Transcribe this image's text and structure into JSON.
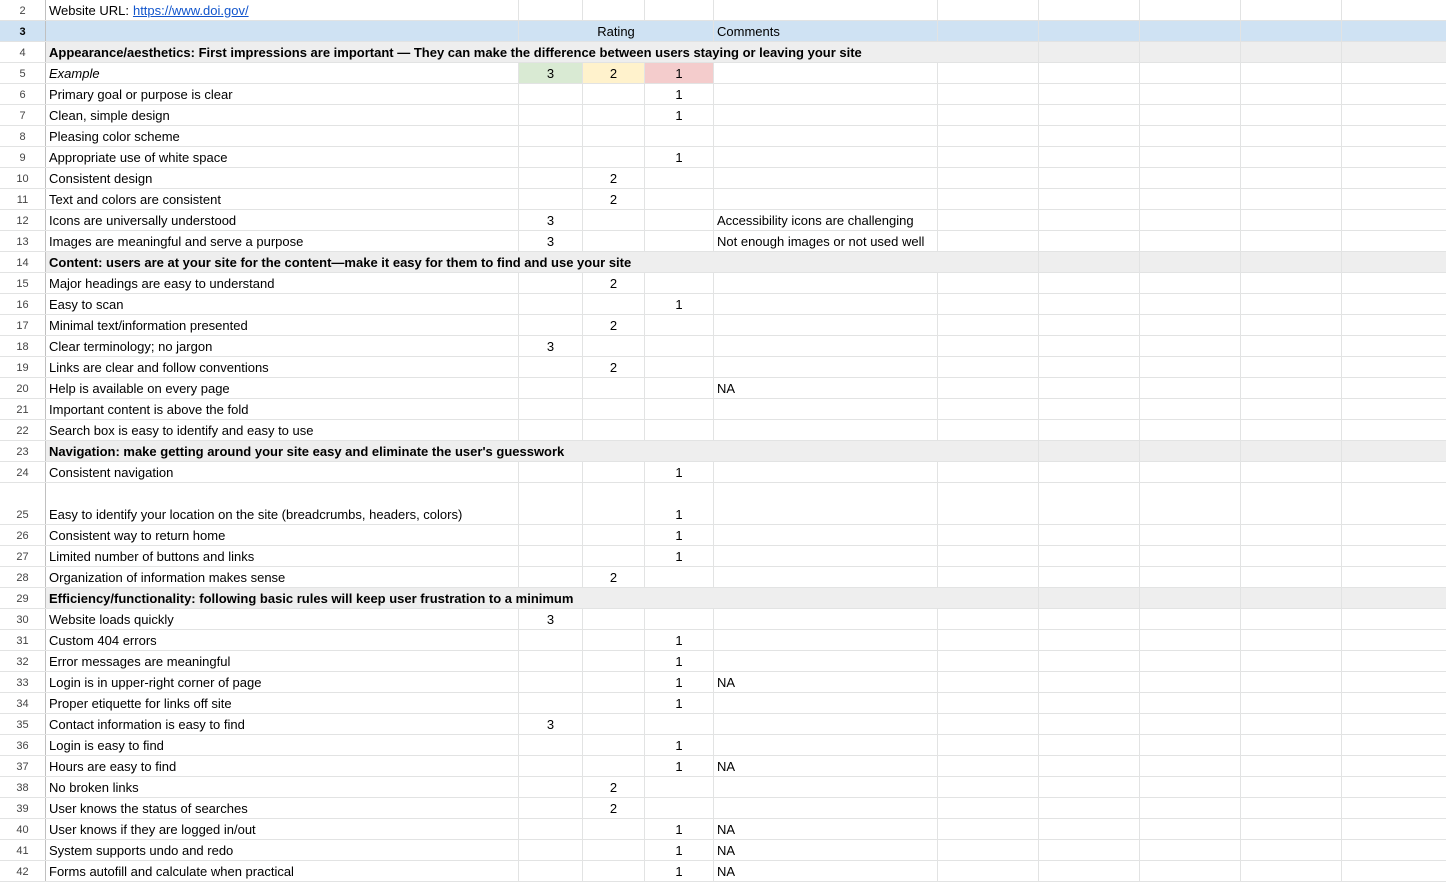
{
  "url_row": {
    "row_num": "2",
    "label": "Website URL:",
    "link": "https://www.doi.gov/"
  },
  "header": {
    "row_num": "3",
    "rating": "Rating",
    "comments": "Comments"
  },
  "rows": [
    {
      "n": "4",
      "type": "section",
      "a": "Appearance/aesthetics: First impressions are important — They can make the difference between users staying or leaving your site"
    },
    {
      "n": "5",
      "type": "example",
      "a": "Example",
      "b": "3",
      "c": "2",
      "d": "1"
    },
    {
      "n": "6",
      "a": "Primary goal or purpose is clear",
      "d": "1"
    },
    {
      "n": "7",
      "a": "Clean, simple design",
      "d": "1"
    },
    {
      "n": "8",
      "a": "Pleasing color scheme"
    },
    {
      "n": "9",
      "a": "Appropriate use of white space",
      "d": "1"
    },
    {
      "n": "10",
      "a": "Consistent design",
      "c": "2"
    },
    {
      "n": "11",
      "a": "Text and colors are consistent",
      "c": "2"
    },
    {
      "n": "12",
      "a": "Icons are universally understood",
      "b": "3",
      "e": "Accessibility icons are challenging"
    },
    {
      "n": "13",
      "a": "Images are meaningful and serve a purpose",
      "b": "3",
      "e": "Not enough images or not used well"
    },
    {
      "n": "14",
      "type": "section",
      "a": "Content: users are at your site for the content—make it easy for them to find and use your site"
    },
    {
      "n": "15",
      "a": "Major headings are easy to understand",
      "c": "2"
    },
    {
      "n": "16",
      "a": "Easy to scan",
      "d": "1"
    },
    {
      "n": "17",
      "a": "Minimal text/information presented",
      "c": "2"
    },
    {
      "n": "18",
      "a": "Clear terminology; no jargon",
      "b": "3"
    },
    {
      "n": "19",
      "a": "Links are clear and follow conventions",
      "c": "2"
    },
    {
      "n": "20",
      "a": "Help is available on every page",
      "e": "NA"
    },
    {
      "n": "21",
      "a": "Important content is above the fold"
    },
    {
      "n": "22",
      "a": "Search box is easy to identify and easy to use"
    },
    {
      "n": "23",
      "type": "section",
      "a": "Navigation: make getting around your site easy and eliminate the user's guesswork"
    },
    {
      "n": "24",
      "a": "Consistent navigation",
      "d": "1"
    },
    {
      "n": "25",
      "type": "tall",
      "a": "Easy to identify your location on the site (breadcrumbs, headers, colors)",
      "d": "1"
    },
    {
      "n": "26",
      "a": "Consistent way to return home",
      "d": "1"
    },
    {
      "n": "27",
      "a": "Limited number of buttons and links",
      "d": "1"
    },
    {
      "n": "28",
      "a": "Organization of information makes sense",
      "c": "2"
    },
    {
      "n": "29",
      "type": "section",
      "a": "Efficiency/functionality: following basic rules will keep user frustration to a minimum"
    },
    {
      "n": "30",
      "a": "Website loads quickly",
      "b": "3"
    },
    {
      "n": "31",
      "a": "Custom 404 errors",
      "d": "1"
    },
    {
      "n": "32",
      "a": "Error messages are meaningful",
      "d": "1"
    },
    {
      "n": "33",
      "a": "Login is in upper-right corner of page",
      "d": "1",
      "e": "NA"
    },
    {
      "n": "34",
      "a": "Proper etiquette for links off site",
      "d": "1"
    },
    {
      "n": "35",
      "a": "Contact information is easy to find",
      "b": "3"
    },
    {
      "n": "36",
      "a": "Login is easy to find",
      "d": "1"
    },
    {
      "n": "37",
      "a": "Hours are easy to find",
      "d": "1",
      "e": "NA"
    },
    {
      "n": "38",
      "a": "No broken links",
      "c": "2"
    },
    {
      "n": "39",
      "a": "User knows the status of searches",
      "c": "2"
    },
    {
      "n": "40",
      "a": "User knows if they are logged in/out",
      "d": "1",
      "e": "NA"
    },
    {
      "n": "41",
      "a": "System supports undo and redo",
      "d": "1",
      "e": "NA"
    },
    {
      "n": "42",
      "a": "Forms autofill and calculate when practical",
      "d": "1",
      "e": "NA"
    }
  ]
}
